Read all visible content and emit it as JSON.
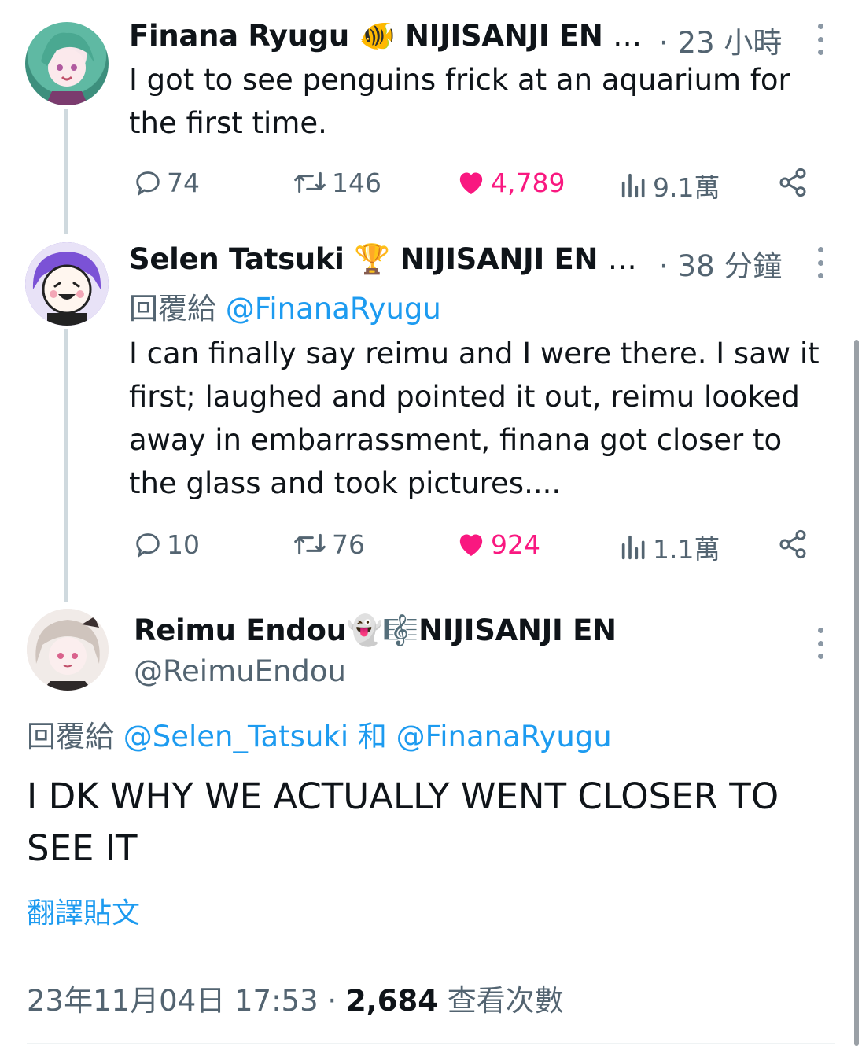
{
  "tweets": [
    {
      "author": "Finana Ryugu",
      "badge_emoji": "🐠",
      "affiliation": "NIJISANJI EN",
      "ellipsis": "…",
      "time": "· 23 小時",
      "text": "I got to see penguins frick at an aquarium for the first time.",
      "actions": {
        "replies": "74",
        "retweets": "146",
        "likes": "4,789",
        "views": "9.1萬"
      }
    },
    {
      "author": "Selen Tatsuki",
      "badge_emoji": "🏆",
      "affiliation": "NIJISANJI EN",
      "ellipsis": "…",
      "time": "· 38 分鐘",
      "reply_prefix": "回覆給",
      "reply_mention": "@FinanaRyugu",
      "text": "I can finally say reimu and I were there. I saw it first; laughed and pointed it out, reimu looked away in embarrassment, finana got closer to the glass and took pictures....",
      "actions": {
        "replies": "10",
        "retweets": "76",
        "likes": "924",
        "views": "1.1萬"
      }
    }
  ],
  "main_tweet": {
    "author": "Reimu Endou",
    "badge_emoji": "👻🎼",
    "affiliation": "NIJISANJI EN",
    "handle": "@ReimuEndou",
    "reply_prefix": "回覆給",
    "reply_mention_1": "@Selen_Tatsuki",
    "reply_and": "和",
    "reply_mention_2": "@FinanaRyugu",
    "text": "I DK WHY WE ACTUALLY WENT CLOSER TO SEE IT",
    "translate": "翻譯貼文",
    "timestamp": "23年11月04日 17:53",
    "dot": "·",
    "view_count": "2,684",
    "views_label": "查看次數"
  },
  "colors": {
    "link": "#1d9bf0",
    "like": "#f91880",
    "muted": "#536471",
    "line": "#cfd9de"
  },
  "icons": [
    "reply-icon",
    "retweet-icon",
    "heart-icon",
    "views-icon",
    "share-icon",
    "more-icon"
  ]
}
